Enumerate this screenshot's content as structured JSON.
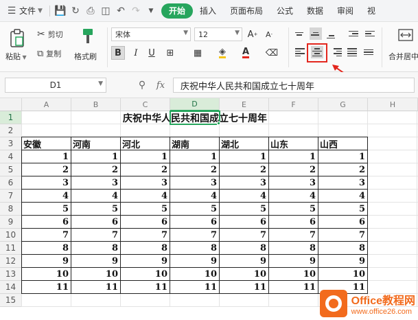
{
  "menu": {
    "file_label": "文件",
    "tabs": [
      "开始",
      "插入",
      "页面布局",
      "公式",
      "数据",
      "审阅",
      "视"
    ],
    "active_tab": "开始"
  },
  "ribbon": {
    "paste_label": "粘贴",
    "cut_label": "剪切",
    "copy_label": "复制",
    "format_painter_label": "格式刷",
    "font_name": "宋体",
    "font_size": "12",
    "merge_center_label": "合并居中"
  },
  "formula_bar": {
    "cell_ref": "D1",
    "fx_label": "fx",
    "content": "庆祝中华人民共和国成立七十周年"
  },
  "sheet": {
    "columns": [
      "A",
      "B",
      "C",
      "D",
      "E",
      "F",
      "G",
      "H"
    ],
    "selected_column": "D",
    "selected_row": 1,
    "rows": [
      "1",
      "2",
      "3",
      "4",
      "5",
      "6",
      "7",
      "8",
      "9",
      "10",
      "11",
      "12",
      "13",
      "14",
      "15"
    ],
    "title": "庆祝中华人民共和国成立七十周年",
    "headers": [
      "安徽",
      "河南",
      "河北",
      "湖南",
      "湖北",
      "山东",
      "山西"
    ],
    "data": [
      [
        1,
        1,
        1,
        1,
        1,
        1,
        1
      ],
      [
        2,
        2,
        2,
        2,
        2,
        2,
        2
      ],
      [
        3,
        3,
        3,
        3,
        3,
        3,
        3
      ],
      [
        4,
        4,
        4,
        4,
        4,
        4,
        4
      ],
      [
        5,
        5,
        5,
        5,
        5,
        5,
        5
      ],
      [
        6,
        6,
        6,
        6,
        6,
        6,
        6
      ],
      [
        7,
        7,
        7,
        7,
        7,
        7,
        7
      ],
      [
        8,
        8,
        8,
        8,
        8,
        8,
        8
      ],
      [
        9,
        9,
        9,
        9,
        9,
        9,
        9
      ],
      [
        10,
        10,
        10,
        10,
        10,
        10,
        10
      ],
      [
        11,
        11,
        11,
        11,
        11,
        11,
        11
      ]
    ]
  },
  "watermark": {
    "brand": "Office教程网",
    "url": "www.office26.com"
  },
  "colors": {
    "accent_green": "#27a55d",
    "highlight_red": "#e3261d",
    "watermark_orange": "#f26b1d"
  }
}
